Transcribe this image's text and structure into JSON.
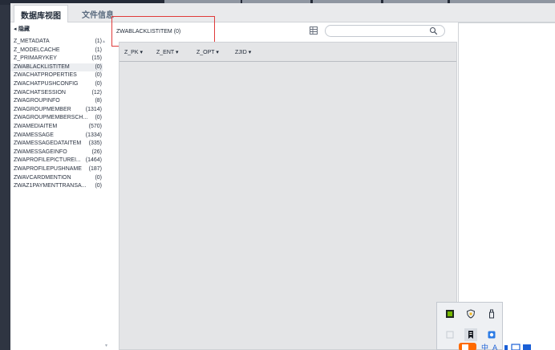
{
  "tabs": [
    {
      "label": "数据库视图",
      "active": true
    },
    {
      "label": "文件信息",
      "active": false
    }
  ],
  "sidebar": {
    "hide_label": "◂ 隐藏",
    "tables": [
      {
        "name": "Z_METADATA",
        "count": "(1)"
      },
      {
        "name": "Z_MODELCACHE",
        "count": "(1)"
      },
      {
        "name": "Z_PRIMARYKEY",
        "count": "(15)"
      },
      {
        "name": "ZWABLACKLISTITEM",
        "count": "(0)",
        "selected": true
      },
      {
        "name": "ZWACHATPROPERTIES",
        "count": "(0)"
      },
      {
        "name": "ZWACHATPUSHCONFIG",
        "count": "(0)"
      },
      {
        "name": "ZWACHATSESSION",
        "count": "(12)"
      },
      {
        "name": "ZWAGROUPINFO",
        "count": "(8)"
      },
      {
        "name": "ZWAGROUPMEMBER",
        "count": "(1314)"
      },
      {
        "name": "ZWAGROUPMEMBERSCH...",
        "count": "(0)"
      },
      {
        "name": "ZWAMEDIAITEM",
        "count": "(570)"
      },
      {
        "name": "ZWAMESSAGE",
        "count": "(1334)"
      },
      {
        "name": "ZWAMESSAGEDATAITEM",
        "count": "(335)"
      },
      {
        "name": "ZWAMESSAGEINFO",
        "count": "(26)"
      },
      {
        "name": "ZWAPROFILEPICTUREI...",
        "count": "(1464)"
      },
      {
        "name": "ZWAPROFILEPUSHNAME",
        "count": "(187)"
      },
      {
        "name": "ZWAVCARDMENTION",
        "count": "(0)"
      },
      {
        "name": "ZWAZ1PAYMENTTRANSA...",
        "count": "(0)"
      }
    ]
  },
  "main": {
    "table_title": "ZWABLACKLISTITEM (0)",
    "search_placeholder": "",
    "columns": [
      "Z_PK ▾",
      "Z_ENT ▾",
      "Z_OPT ▾",
      "ZJID ▾"
    ]
  },
  "tray": {
    "icons": [
      "nvidia-icon",
      "security-shield-icon",
      "usb-drive-icon",
      "blank-app-icon",
      "bookmark-app-icon",
      "screenshot-app-icon"
    ]
  },
  "colors": {
    "accent_red": "#e03b3b",
    "background": "#2f3542",
    "selected_row": "#eceef1"
  }
}
